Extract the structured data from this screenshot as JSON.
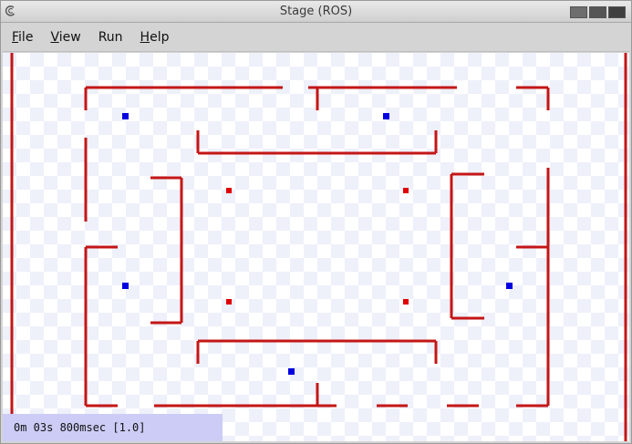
{
  "window": {
    "title": "Stage (ROS)",
    "app_icon": "debian-swirl-icon"
  },
  "menu": {
    "items": [
      {
        "label": "File",
        "underline": "F",
        "rest": "ile"
      },
      {
        "label": "View",
        "underline": "V",
        "rest": "iew"
      },
      {
        "label": "Run",
        "underline": "",
        "rest": "Run"
      },
      {
        "label": "Help",
        "underline": "H",
        "rest": "elp"
      }
    ]
  },
  "status": {
    "clock": "0m 03s 800msec [1.0]"
  },
  "colors": {
    "wall": "#c41616",
    "robot_blue": "#0000e0",
    "target_red": "#e00000",
    "checker_light": "#ffffff",
    "checker_dark": "#eef0fa",
    "status_bg": "#ccccf6"
  }
}
